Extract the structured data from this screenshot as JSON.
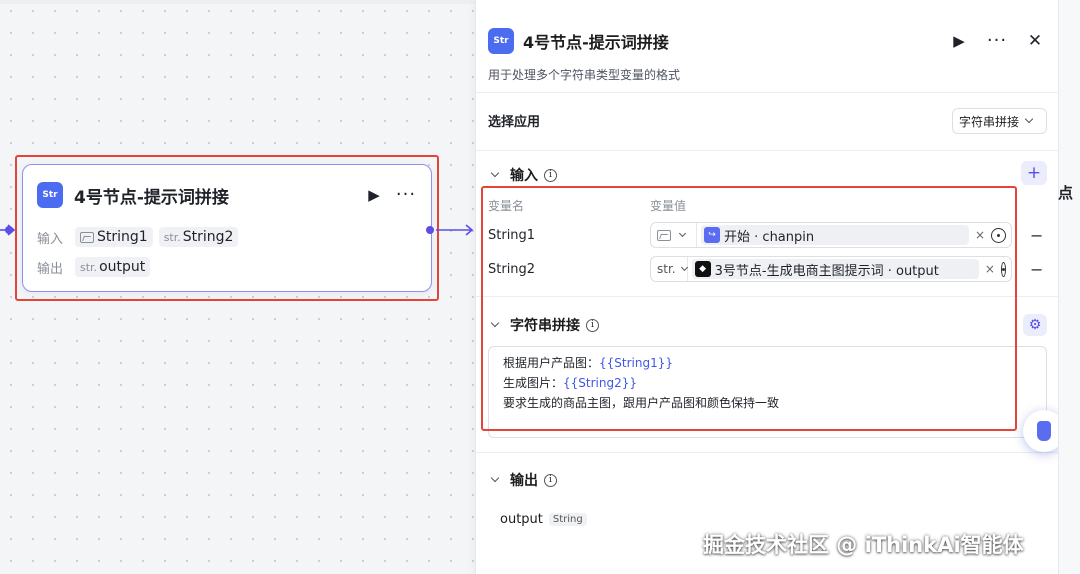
{
  "node_card": {
    "icon_label": "Str",
    "title": "4号节点-提示词拼接",
    "input_label": "输入",
    "inputs": [
      {
        "type_icon": "image-icon",
        "name": "String1"
      },
      {
        "type_prefix": "str.",
        "name": "String2"
      }
    ],
    "output_label": "输出",
    "outputs": [
      {
        "type_prefix": "str.",
        "name": "output"
      }
    ]
  },
  "panel": {
    "icon_label": "Str",
    "title": "4号节点-提示词拼接",
    "description": "用于处理多个字符串类型变量的格式",
    "select_app_label": "选择应用",
    "select_app_value": "字符串拼接",
    "input_section": {
      "title": "输入",
      "col_name": "变量名",
      "col_value": "变量值",
      "rows": [
        {
          "name": "String1",
          "type": "",
          "type_icon": "image-icon",
          "ref_icon": "start-icon",
          "ref_node": "开始",
          "ref_var": "chanpin"
        },
        {
          "name": "String2",
          "type": "str.",
          "type_icon": "",
          "ref_icon": "node-icon",
          "ref_node": "3号节点-生成电商主图提示词",
          "ref_var": "output"
        }
      ]
    },
    "concat_section": {
      "title": "字符串拼接",
      "lines": [
        {
          "text": "根据用户产品图：",
          "var": "{{String1}}"
        },
        {
          "text": "生成图片：",
          "var": "{{String2}}"
        },
        {
          "text": "要求生成的商品主图，跟用户产品图和颜色保持一致",
          "var": ""
        }
      ]
    },
    "output_section": {
      "title": "输出",
      "var_name": "output",
      "var_type": "String"
    }
  },
  "right_strip_text": "点",
  "watermark": "掘金技术社区 @ iThinkAi智能体",
  "colors": {
    "accent": "#5a4ee6",
    "highlight_box": "#e3453b",
    "app_icon": "#4b6cf0"
  }
}
